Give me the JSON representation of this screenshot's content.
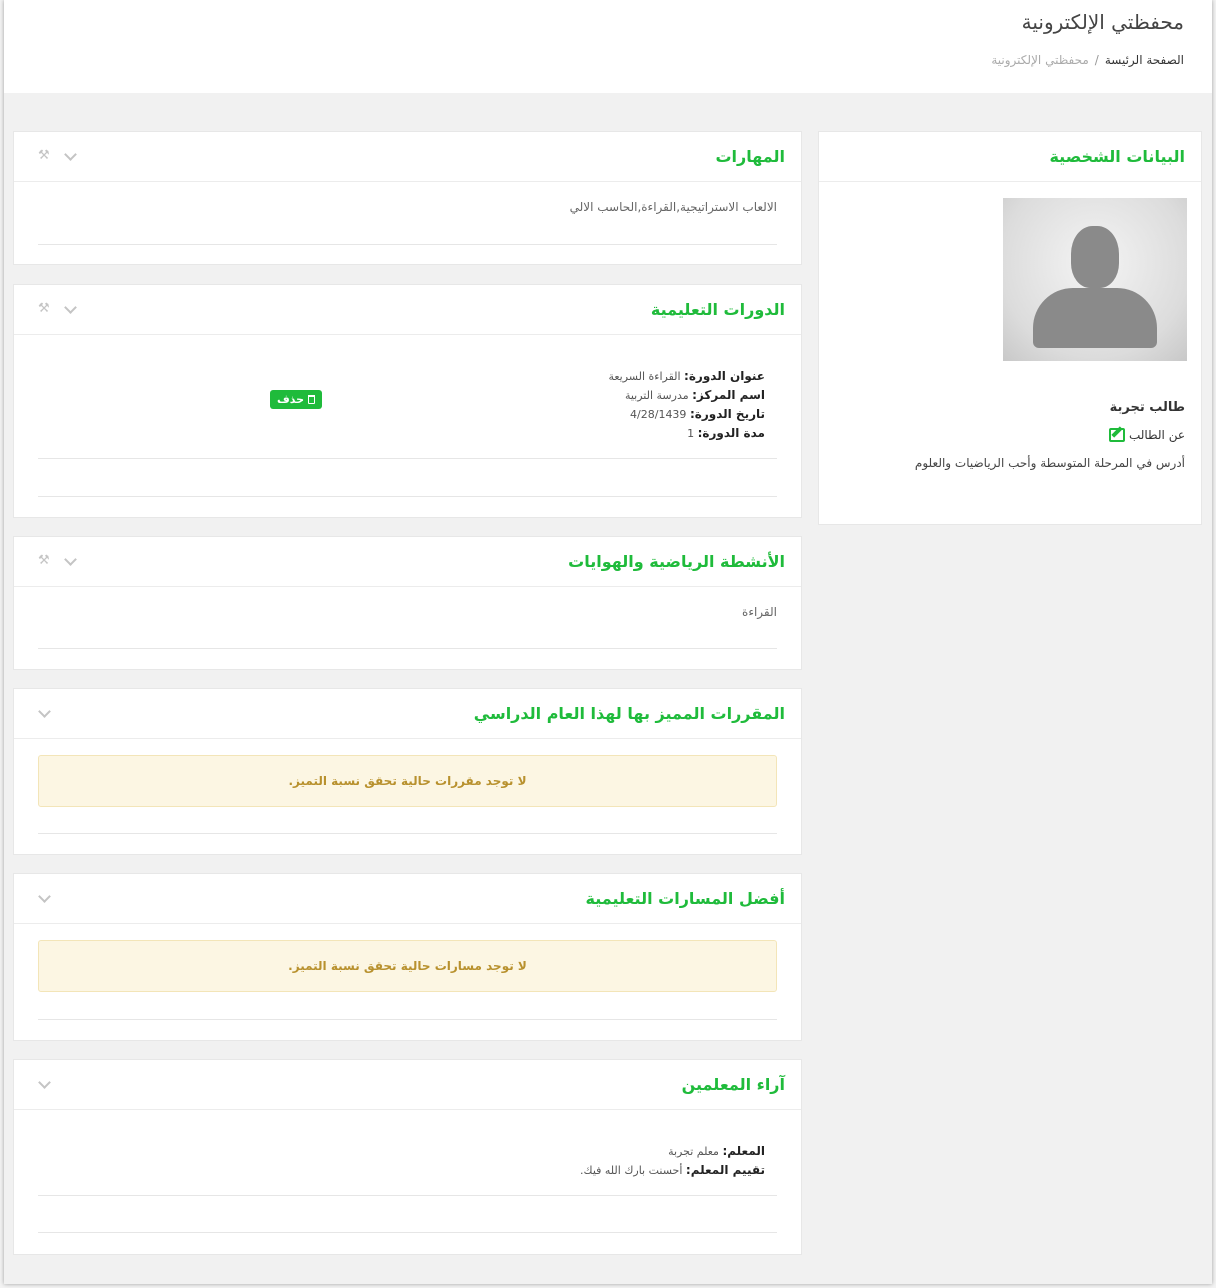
{
  "header": {
    "title": "محفظتي الإلكترونية",
    "breadcrumb": {
      "home": "الصفحة الرئيسة",
      "separator": "/",
      "current": "محفظتي الإلكترونية"
    }
  },
  "profile": {
    "title": "البيانات الشخصية",
    "student_name": "طالب تجربة",
    "about_label": "عن الطالب",
    "about_text": "أدرس في المرحلة المتوسطة وأحب الرياضيات والعلوم"
  },
  "skills": {
    "title": "المهارات",
    "text": "الالعاب الاستراتيجية,القراءة,الحاسب الالي"
  },
  "courses": {
    "title": "الدورات التعليمية",
    "delete_label": "حذف",
    "fields": [
      {
        "key": "عنوان الدورة:",
        "value": "القراءة السريعة"
      },
      {
        "key": "اسم المركز:",
        "value": "مدرسة التربية"
      },
      {
        "key": "تاريخ الدورة:",
        "value": "4/28/1439"
      },
      {
        "key": "مدة الدورة:",
        "value": "1"
      }
    ]
  },
  "activities": {
    "title": "الأنشطة الرياضية والهوايات",
    "text": "القراءة"
  },
  "distinguished_courses": {
    "title": "المقررات المميز بها لهذا العام الدراسي",
    "alert": "لا توجد مقررات حالية تحقق نسبة التميز."
  },
  "best_tracks": {
    "title": "أفضل المسارات التعليمية",
    "alert": "لا توجد مسارات حالية تحقق نسبة التميز."
  },
  "teacher_opinions": {
    "title": "آراء المعلمين",
    "fields": [
      {
        "key": "المعلم:",
        "value": "معلم تجربة"
      },
      {
        "key": "تقييم المعلم:",
        "value": "أحسنت بارك الله فيك."
      }
    ]
  },
  "icons": {
    "collapse": "chevron-down-icon",
    "settings": "wrench-icon",
    "edit": "edit-icon",
    "delete": "trash-icon"
  },
  "colors": {
    "accent": "#1fbb3b",
    "alert_bg": "#fcf6e3",
    "alert_text": "#b8912e"
  }
}
